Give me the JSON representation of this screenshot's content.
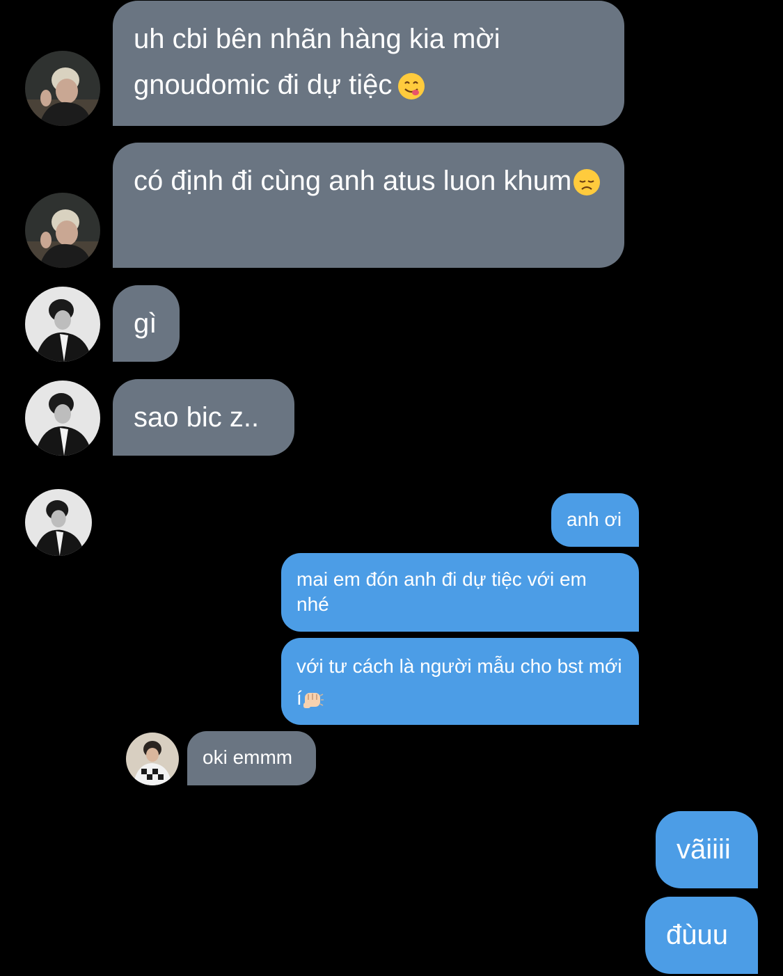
{
  "messages": [
    {
      "id": "m1",
      "text": "uh cbi bên nhãn hàng kia mời gnoudomic đi dự tiệc",
      "emoji": "yum-face-emoji"
    },
    {
      "id": "m2",
      "text": "có định đi cùng anh atus luon khum",
      "emoji": "disappointed-face-emoji"
    },
    {
      "id": "m3",
      "text": "gì"
    },
    {
      "id": "m4",
      "text": "sao bic z.."
    },
    {
      "id": "m5",
      "text": "anh ơi"
    },
    {
      "id": "m6",
      "text": "mai em đón anh đi dự tiệc với em nhé"
    },
    {
      "id": "m7",
      "text": "với tư cách là người mẫu cho bst mới í",
      "emoji": "fist-bump-emoji"
    },
    {
      "id": "m8",
      "text": "oki emmm"
    },
    {
      "id": "m9",
      "text": "vãiiii"
    },
    {
      "id": "m10",
      "text": "đùuu"
    }
  ],
  "colors": {
    "background": "#000000",
    "incoming_bubble": "#6a7582",
    "outgoing_bubble": "#4c9de6",
    "text": "#ffffff"
  }
}
